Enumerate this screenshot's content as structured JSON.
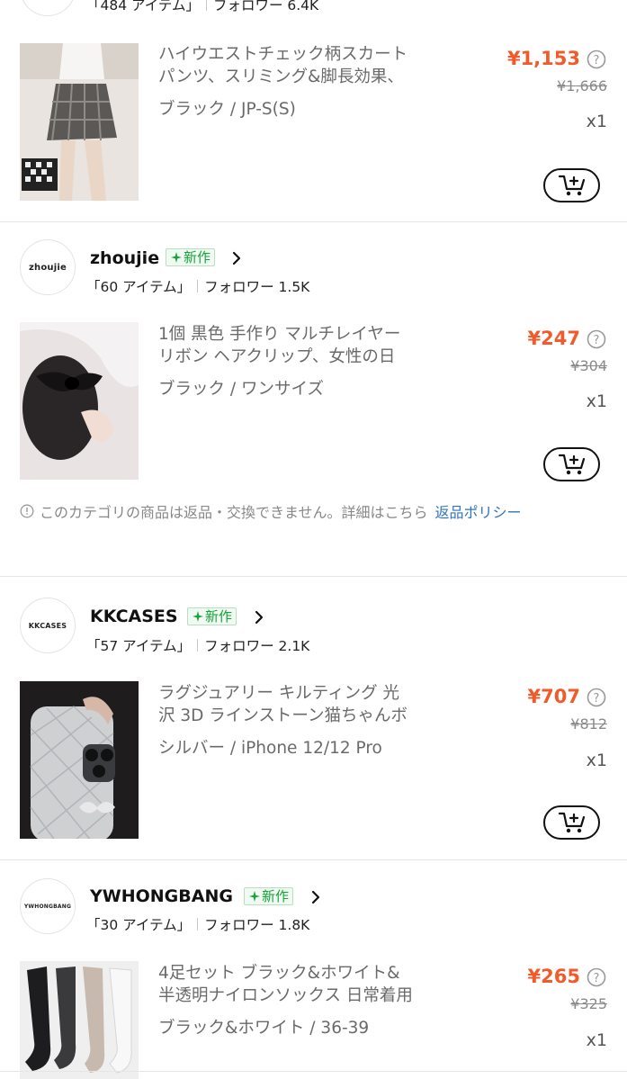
{
  "colors": {
    "price": "#f25a2a",
    "badge_green": "#15a33c",
    "link": "#2f74c0",
    "muted": "#888888"
  },
  "top_store": {
    "items": "「484 アイテム」",
    "followers": "フォロワー 6.4K"
  },
  "product_1": {
    "title_line1": "ハイウエストチェック柄スカート",
    "title_line2": "パンツ、スリミング&脚長効果、",
    "variant": "ブラック / JP-S(S)",
    "price": "¥1,153",
    "original_price": "¥1,666",
    "quantity": "x1"
  },
  "store_2": {
    "logo_text": "zhoujie",
    "name": "zhoujie",
    "badge": "新作",
    "items": "「60 アイテム」",
    "followers": "フォロワー 1.5K"
  },
  "product_2": {
    "title_line1": "1個 黒色 手作り マルチレイヤー",
    "title_line2": "リボン ヘアクリップ、女性の日",
    "variant": "ブラック / ワンサイズ",
    "price": "¥247",
    "original_price": "¥304",
    "quantity": "x1"
  },
  "notice": {
    "text": "このカテゴリの商品は返品・交換できません。詳細はこちら",
    "link": "返品ポリシー"
  },
  "store_3": {
    "logo_text": "KKCASES",
    "name": "KKCASES",
    "badge": "新作",
    "items": "「57 アイテム」",
    "followers": "フォロワー 2.1K"
  },
  "product_3": {
    "title_line1": "ラグジュアリー キルティング 光",
    "title_line2": "沢 3D ラインストーン猫ちゃんボ",
    "variant": "シルバー / iPhone 12/12 Pro",
    "price": "¥707",
    "original_price": "¥812",
    "quantity": "x1"
  },
  "store_4": {
    "logo_text": "YWHONGBANG",
    "name": "YWHONGBANG",
    "badge": "新作",
    "items": "「30 アイテム」",
    "followers": "フォロワー 1.8K"
  },
  "product_4": {
    "title_line1": "4足セット ブラック&ホワイト&",
    "title_line2": "半透明ナイロンソックス 日常着用",
    "variant": "ブラック&ホワイト / 36-39",
    "price": "¥265",
    "original_price": "¥325",
    "quantity": "x1"
  }
}
